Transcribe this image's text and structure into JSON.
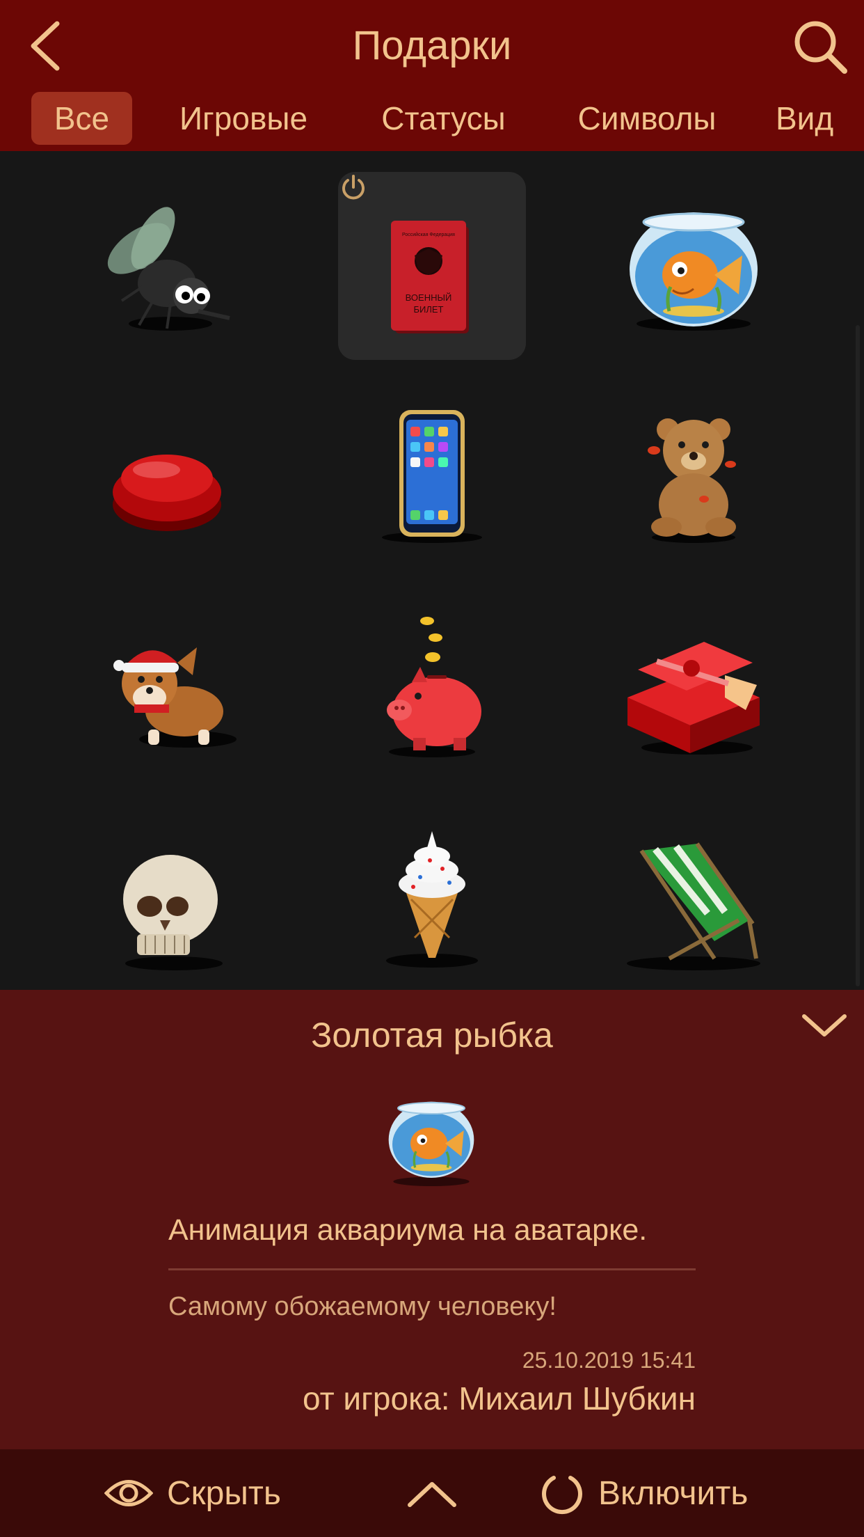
{
  "header": {
    "title": "Подарки",
    "back_icon": "chevron-left-icon",
    "search_icon": "search-icon"
  },
  "tabs": [
    {
      "label": "Все",
      "active": true
    },
    {
      "label": "Игровые",
      "active": false
    },
    {
      "label": "Статусы",
      "active": false
    },
    {
      "label": "Символы",
      "active": false
    },
    {
      "label": "Вид",
      "active": false
    }
  ],
  "gifts": [
    {
      "name": "fly-gift",
      "icon": "fly-icon"
    },
    {
      "name": "military-id-gift",
      "icon": "military-id-icon",
      "book_line1": "ВОЕННЫЙ",
      "book_line2": "БИЛЕТ",
      "book_header": "Российская Федерация",
      "selected": true,
      "active_mark": "power-icon"
    },
    {
      "name": "goldfish-gift",
      "icon": "goldfish-bowl-icon"
    },
    {
      "name": "red-button-gift",
      "icon": "red-button-icon"
    },
    {
      "name": "smartphone-gift",
      "icon": "smartphone-icon"
    },
    {
      "name": "teddy-bear-gift",
      "icon": "teddy-bear-icon"
    },
    {
      "name": "corgi-gift",
      "icon": "corgi-santa-hat-icon"
    },
    {
      "name": "piggy-bank-gift",
      "icon": "piggy-bank-icon"
    },
    {
      "name": "gift-box-gift",
      "icon": "gift-box-icon"
    },
    {
      "name": "skull-gift",
      "icon": "skull-icon"
    },
    {
      "name": "ice-cream-gift",
      "icon": "ice-cream-icon"
    },
    {
      "name": "deck-chair-gift",
      "icon": "deck-chair-icon"
    }
  ],
  "detail": {
    "title": "Золотая рыбка",
    "icon": "goldfish-bowl-icon",
    "description": "Анимация аквариума на аватарке.",
    "message": "Самому обожаемому человеку!",
    "date": "25.10.2019 15:41",
    "sender": "от игрока: Михаил Шубкин",
    "collapse_icon": "chevron-down-icon"
  },
  "bottom_bar": {
    "hide_label": "Скрыть",
    "hide_icon": "eye-icon",
    "expand_icon": "chevron-up-icon",
    "enable_label": "Включить",
    "enable_icon": "power-icon"
  },
  "colors": {
    "header_bg": "#6c0705",
    "accent_text": "#f2c38d",
    "active_tab_bg": "#a0301f",
    "grid_bg": "#171717",
    "panel_bg": "#571312",
    "bottom_bg": "#3a0a08"
  }
}
